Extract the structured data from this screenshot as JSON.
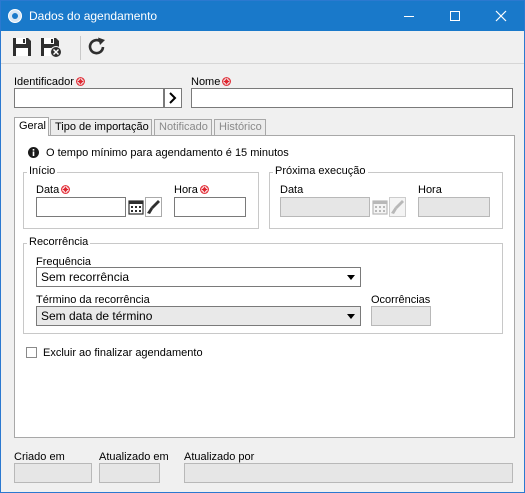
{
  "window": {
    "title": "Dados do agendamento"
  },
  "toolbar": {
    "icons": [
      "save-icon",
      "save-and-close-icon",
      "refresh-icon"
    ]
  },
  "form": {
    "identificador_label": "Identificador",
    "identificador_value": "",
    "nome_label": "Nome",
    "nome_value": ""
  },
  "tabs": [
    {
      "label": "Geral",
      "active": true,
      "enabled": true
    },
    {
      "label": "Tipo de importação",
      "active": false,
      "enabled": true
    },
    {
      "label": "Notificado",
      "active": false,
      "enabled": false
    },
    {
      "label": "Histórico",
      "active": false,
      "enabled": false
    }
  ],
  "geral": {
    "info_text": "O tempo mínimo para agendamento é 15 minutos",
    "inicio": {
      "legend": "Início",
      "data_label": "Data",
      "data_value": "",
      "hora_label": "Hora",
      "hora_value": ""
    },
    "proxima": {
      "legend": "Próxima execução",
      "data_label": "Data",
      "data_value": "",
      "hora_label": "Hora",
      "hora_value": ""
    },
    "recorrencia": {
      "legend": "Recorrência",
      "frequencia_label": "Frequência",
      "frequencia_value": "Sem recorrência",
      "termino_label": "Término da recorrência",
      "termino_value": "Sem data de término",
      "ocorrencias_label": "Ocorrências",
      "ocorrencias_value": ""
    },
    "excluir_label": "Excluir ao finalizar agendamento",
    "excluir_checked": false
  },
  "footer": {
    "criado_em_label": "Criado em",
    "atualizado_em_label": "Atualizado em",
    "atualizado_por_label": "Atualizado por"
  },
  "colors": {
    "titlebar": "#1979ca",
    "required": "#e0202a"
  }
}
